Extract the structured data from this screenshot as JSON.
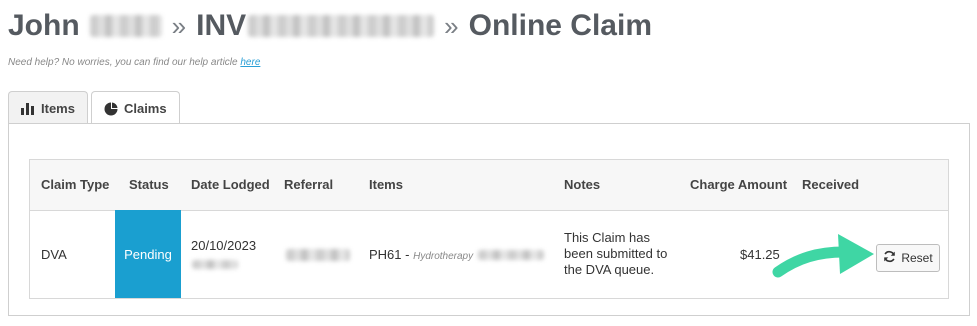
{
  "header": {
    "name_prefix": "John",
    "separator": "»",
    "invoice_prefix": "INV",
    "page_name": "Online Claim"
  },
  "help": {
    "text": "Need help? No worries, you can find our help article ",
    "link_label": "here"
  },
  "tabs": [
    {
      "label": "Items",
      "icon": "bar-chart-icon",
      "active": false
    },
    {
      "label": "Claims",
      "icon": "pie-chart-icon",
      "active": true
    }
  ],
  "table": {
    "columns": [
      "Claim Type",
      "Status",
      "Date Lodged",
      "Referral",
      "Items",
      "Notes",
      "Charge Amount",
      "Received"
    ],
    "rows": [
      {
        "claim_type": "DVA",
        "status": "Pending",
        "date_lodged": "20/10/2023",
        "item_code": "PH61",
        "item_dash": " - ",
        "item_name": "Hydrotherapy",
        "notes": "This Claim has been submitted to the DVA queue.",
        "charge_amount": "$41.25",
        "received": ""
      }
    ]
  },
  "actions": {
    "reset_label": "Reset"
  },
  "colors": {
    "status_pending": "#1a9fd0",
    "arrow": "#3fd6a4",
    "link": "#2a9fd6"
  }
}
